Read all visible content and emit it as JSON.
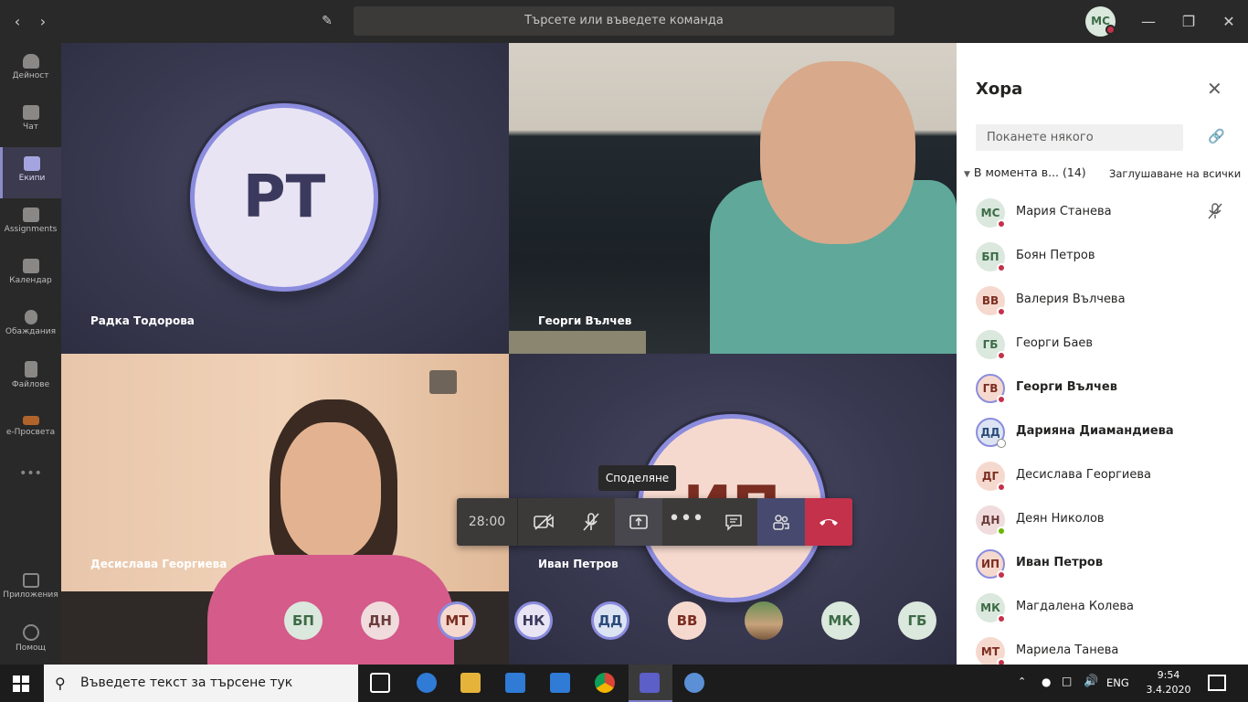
{
  "titlebar": {
    "back_icon": "chevron-left-icon",
    "forward_icon": "chevron-right-icon",
    "compose_icon": "compose-icon",
    "search_placeholder": "Търсете или въведете команда",
    "me_initials": "МС",
    "minimize": "—",
    "maximize": "❐",
    "close": "✕"
  },
  "rail": [
    {
      "label": "Дейност",
      "icon": "bell-icon"
    },
    {
      "label": "Чат",
      "icon": "chat-icon"
    },
    {
      "label": "Екипи",
      "icon": "teams-icon",
      "active": true
    },
    {
      "label": "Assignments",
      "icon": "assignments-icon"
    },
    {
      "label": "Календар",
      "icon": "calendar-icon"
    },
    {
      "label": "Обаждания",
      "icon": "phone-icon"
    },
    {
      "label": "Файлове",
      "icon": "files-icon"
    },
    {
      "label": "е-Просвета",
      "icon": "eprosveta-icon"
    },
    {
      "label": "Приложения",
      "icon": "apps-icon"
    },
    {
      "label": "Помощ",
      "icon": "help-icon"
    }
  ],
  "rail_more": "•••",
  "tiles": {
    "t1": {
      "name": "Радка Тодорова",
      "initials": "РТ"
    },
    "t2": {
      "name": "Георги Вълчев"
    },
    "t3": {
      "name": "Десислава Георгиева"
    },
    "t4": {
      "name": "Иван Петров",
      "initials": "ИП"
    }
  },
  "controls": {
    "timer": "28:00",
    "tooltip": "Споделяне",
    "camera_icon": "camera-off-icon",
    "mic_icon": "mic-off-icon",
    "share_icon": "share-tray-icon",
    "more_icon": "more-options-icon",
    "chat_icon": "chat-icon",
    "people_icon": "participants-icon",
    "hangup_icon": "hang-up-icon"
  },
  "roster": [
    {
      "initials": "БП"
    },
    {
      "initials": "ДН"
    },
    {
      "initials": "МТ"
    },
    {
      "initials": "НК"
    },
    {
      "initials": "ДД"
    },
    {
      "initials": "ВВ"
    },
    {
      "initials": ""
    },
    {
      "initials": "МК"
    },
    {
      "initials": "ГБ"
    }
  ],
  "panel": {
    "title": "Хора",
    "close": "✕",
    "invite_placeholder": "Поканете някого",
    "section": "В момента в... (14)",
    "mute_all": "Заглушаване на всички",
    "people": [
      {
        "initials": "МС",
        "name": "Мария Станева",
        "status": "busy",
        "bold": false
      },
      {
        "initials": "БП",
        "name": "Боян Петров",
        "status": "busy",
        "bold": false
      },
      {
        "initials": "ВВ",
        "name": "Валерия Вълчева",
        "status": "busy",
        "bold": false
      },
      {
        "initials": "ГБ",
        "name": "Георги Баев",
        "status": "busy",
        "bold": false
      },
      {
        "initials": "ГВ",
        "name": "Георги Вълчев",
        "status": "busy",
        "bold": true
      },
      {
        "initials": "ДД",
        "name": "Дарияна Диамандиева",
        "status": "offline",
        "bold": true
      },
      {
        "initials": "ДГ",
        "name": "Десислава Георгиева",
        "status": "busy",
        "bold": false
      },
      {
        "initials": "ДН",
        "name": "Деян Николов",
        "status": "available",
        "bold": false
      },
      {
        "initials": "ИП",
        "name": "Иван Петров",
        "status": "busy",
        "bold": true
      },
      {
        "initials": "МК",
        "name": "Магдалена Колева",
        "status": "busy",
        "bold": false
      },
      {
        "initials": "МТ",
        "name": "Мариела Танева",
        "status": "busy",
        "bold": false
      }
    ]
  },
  "taskbar": {
    "search_placeholder": "Въведете текст за търсене тук",
    "lang": "ENG",
    "time": "9:54",
    "date": "3.4.2020 г."
  }
}
